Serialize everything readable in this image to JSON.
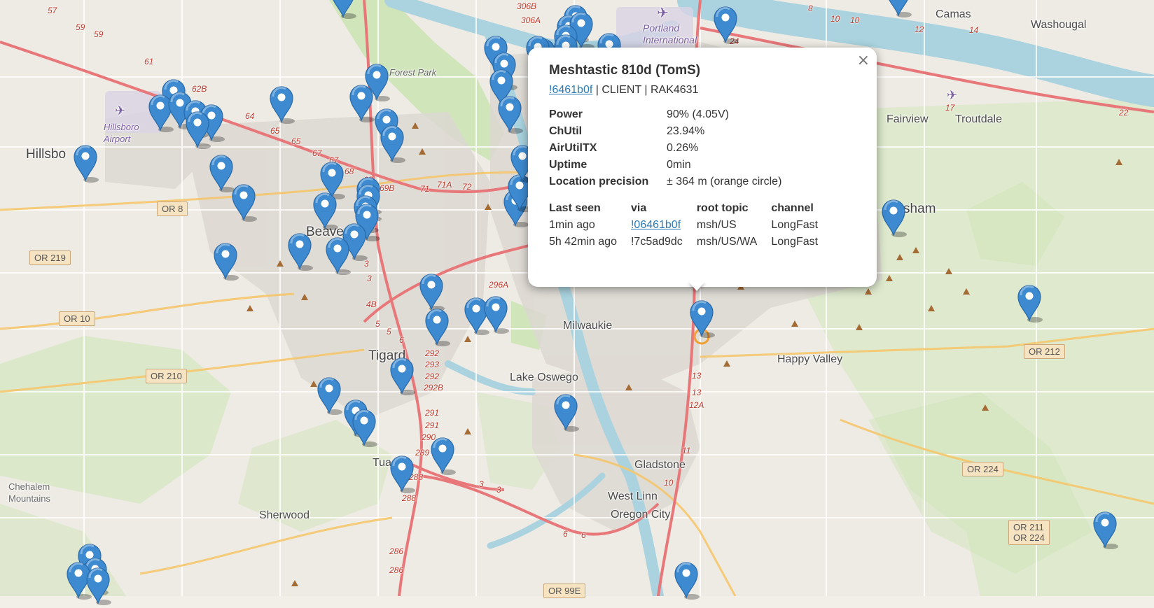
{
  "map": {
    "places": {
      "camas": "Camas",
      "washougal": "Washougal",
      "portland_intl": "Portland\nInternational",
      "forest_park": "Forest Park",
      "hillsboro_airport": "Hillsboro\nAirport",
      "hillsboro": "Hillsbo",
      "beaverton": "Beaverton",
      "fairview": "Fairview",
      "troutdale": "Troutdale",
      "gresham": "sham",
      "milwaukie": "Milwaukie",
      "happy_valley": "Happy Valley",
      "tigard": "Tigard",
      "lake_oswego": "Lake Oswego",
      "tualatin": "Tua",
      "gladstone": "Gladstone",
      "west_linn": "West Linn",
      "oregon_city": "Oregon City",
      "sherwood": "Sherwood",
      "chehalem": "Chehalem\nMountains"
    },
    "shields": {
      "or8": "OR 8",
      "or219": "OR 219",
      "or10": "OR 10",
      "or210": "OR 210",
      "or212": "OR 212",
      "or224": "OR 224",
      "or211_224": "OR 211\nOR 224",
      "or99e": "OR 99E"
    },
    "route_numbers": [
      "57",
      "59",
      "59",
      "61",
      "62B",
      "64",
      "65",
      "65",
      "67",
      "67",
      "68",
      "68",
      "69B",
      "71",
      "71A",
      "72",
      "306B",
      "306A",
      "8",
      "10",
      "10",
      "12",
      "14",
      "17",
      "22",
      "24",
      "3",
      "3",
      "4B",
      "5",
      "5",
      "6",
      "292",
      "293",
      "292",
      "292B",
      "291",
      "291",
      "290",
      "289",
      "288",
      "288",
      "286",
      "286",
      "296A",
      "13",
      "13",
      "12A",
      "11",
      "10",
      "6",
      "6",
      "3",
      "3"
    ],
    "markers": [
      {
        "title": "node"
      }
    ]
  },
  "popup": {
    "title": "Meshtastic 810d (TomS)",
    "node_id": "!6461b0f",
    "role_hw": " | CLIENT | RAK4631",
    "close_label": "×",
    "stats": [
      {
        "k": "Power",
        "v": "90% (4.05V)"
      },
      {
        "k": "ChUtil",
        "v": "23.94%"
      },
      {
        "k": "AirUtilTX",
        "v": "0.26%"
      },
      {
        "k": "Uptime",
        "v": "0min"
      },
      {
        "k": "Location precision",
        "v": "± 364 m (orange circle)"
      }
    ],
    "seen_headers": {
      "last_seen": "Last seen",
      "via": "via",
      "root_topic": "root topic",
      "channel": "channel"
    },
    "seen_rows": [
      {
        "last_seen": "1min ago",
        "via": "!06461b0f",
        "root_topic": "msh/US",
        "channel": "LongFast"
      },
      {
        "last_seen": "5h 42min ago",
        "via": "!7c5ad9dc",
        "root_topic": "msh/US/WA",
        "channel": "LongFast"
      }
    ]
  },
  "colors": {
    "marker": "#3d8ad0",
    "river": "#aad3df",
    "park": "#c8e6b0",
    "road": "#e8777a",
    "precision_circle": "#f0a030"
  }
}
